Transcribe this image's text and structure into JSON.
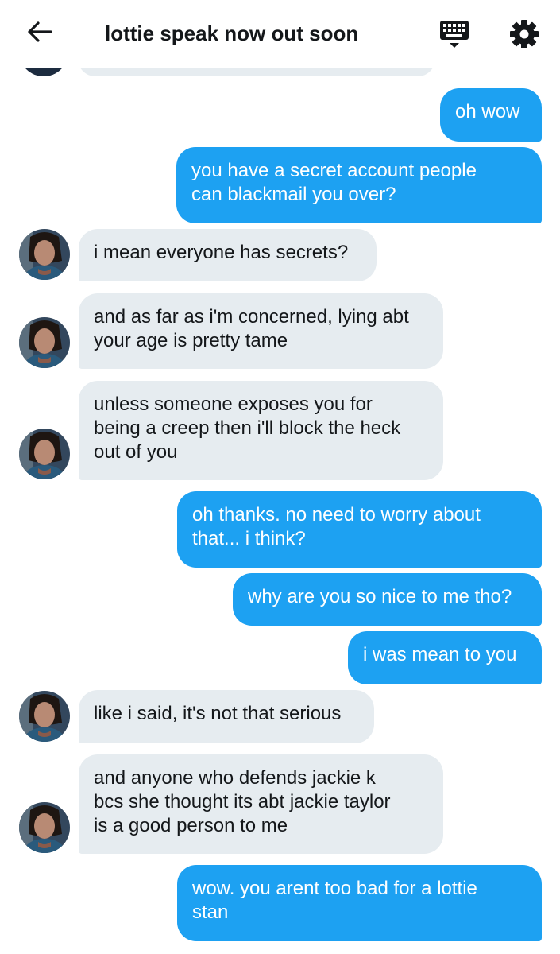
{
  "header": {
    "title": "lottie speak now out soon"
  },
  "messages": [
    {
      "side": "sent",
      "text": "oh wow"
    },
    {
      "side": "sent",
      "text": "you have a secret account people\ncan blackmail you over?"
    },
    {
      "side": "received",
      "text": "i mean everyone has secrets?"
    },
    {
      "side": "received",
      "text": "and as far as i'm concerned, lying abt\nyour age is pretty tame"
    },
    {
      "side": "received",
      "text": "unless someone exposes you for\nbeing a creep then i'll block the heck\nout of you"
    },
    {
      "side": "sent",
      "text": "oh thanks. no need to worry about\nthat... i think?"
    },
    {
      "side": "sent",
      "text": "why are you so nice to me tho?"
    },
    {
      "side": "sent",
      "text": "i was mean to you"
    },
    {
      "side": "received",
      "text": "like i said, it's not that serious"
    },
    {
      "side": "received",
      "text": "and anyone who defends jackie k\nbcs she thought its abt jackie taylor\nis a good person to me"
    },
    {
      "side": "sent",
      "text": "wow. you arent too bad for a lottie\nstan"
    }
  ],
  "icons": {
    "back": "arrow-left-icon",
    "keyboard": "keyboard-icon",
    "settings": "gear-icon"
  },
  "colors": {
    "sent_bubble": "#1da1f2",
    "received_bubble": "#e6ecf0",
    "text_dark": "#14171a"
  }
}
